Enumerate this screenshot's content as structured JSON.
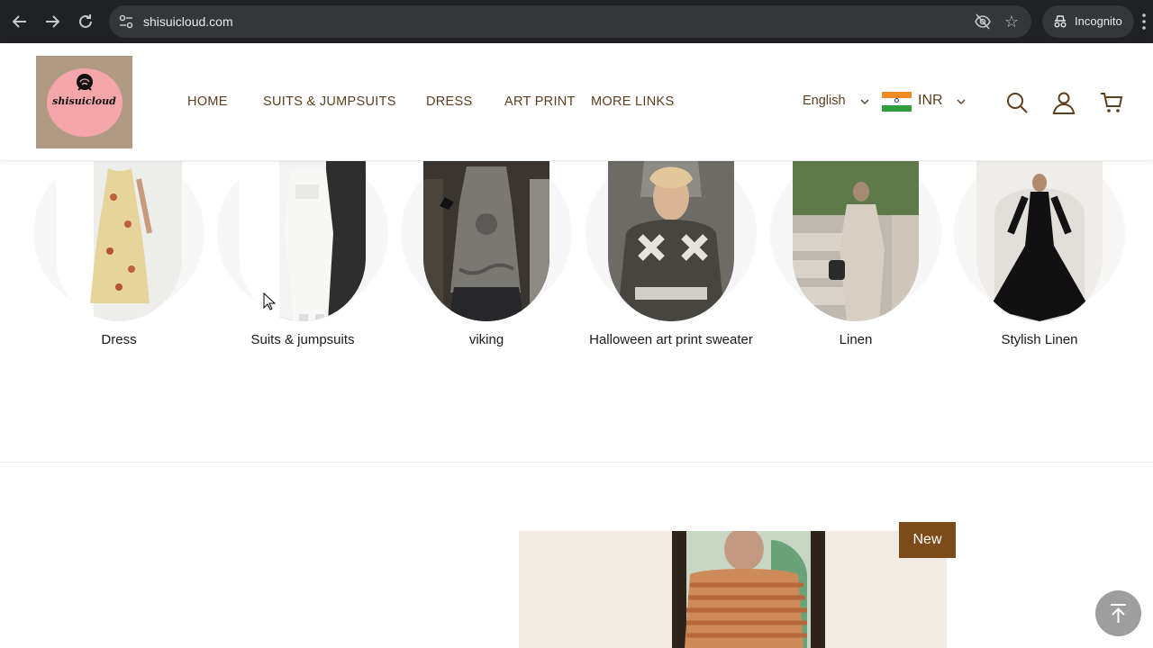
{
  "browser": {
    "url": "shisuicloud.com",
    "incognito_label": "Incognito",
    "icons": [
      "back-arrow-icon",
      "forward-arrow-icon",
      "reload-icon",
      "site-settings-icon",
      "eye-off-icon",
      "star-icon",
      "incognito-icon",
      "more-vert-icon"
    ]
  },
  "header": {
    "logo_text": "shisuicloud",
    "nav": [
      {
        "label": "HOME"
      },
      {
        "label": "SUITS & JUMPSUITS"
      },
      {
        "label": "DRESS"
      },
      {
        "label": "ART PRINT"
      },
      {
        "label": "MORE LINKS"
      }
    ],
    "language": "English",
    "currency": "INR",
    "accent_color": "#5c3e1c",
    "icons": [
      "search-icon",
      "account-icon",
      "cart-icon"
    ]
  },
  "categories": [
    {
      "label": "Dress"
    },
    {
      "label": "Suits & jumpsuits"
    },
    {
      "label": "viking"
    },
    {
      "label": "Halloween art print sweater"
    },
    {
      "label": "Linen"
    },
    {
      "label": "Stylish Linen"
    }
  ],
  "product": {
    "badge": "New",
    "badge_color": "#7d4a1a"
  },
  "scroll_to_top_icon": "arrow-up-icon"
}
